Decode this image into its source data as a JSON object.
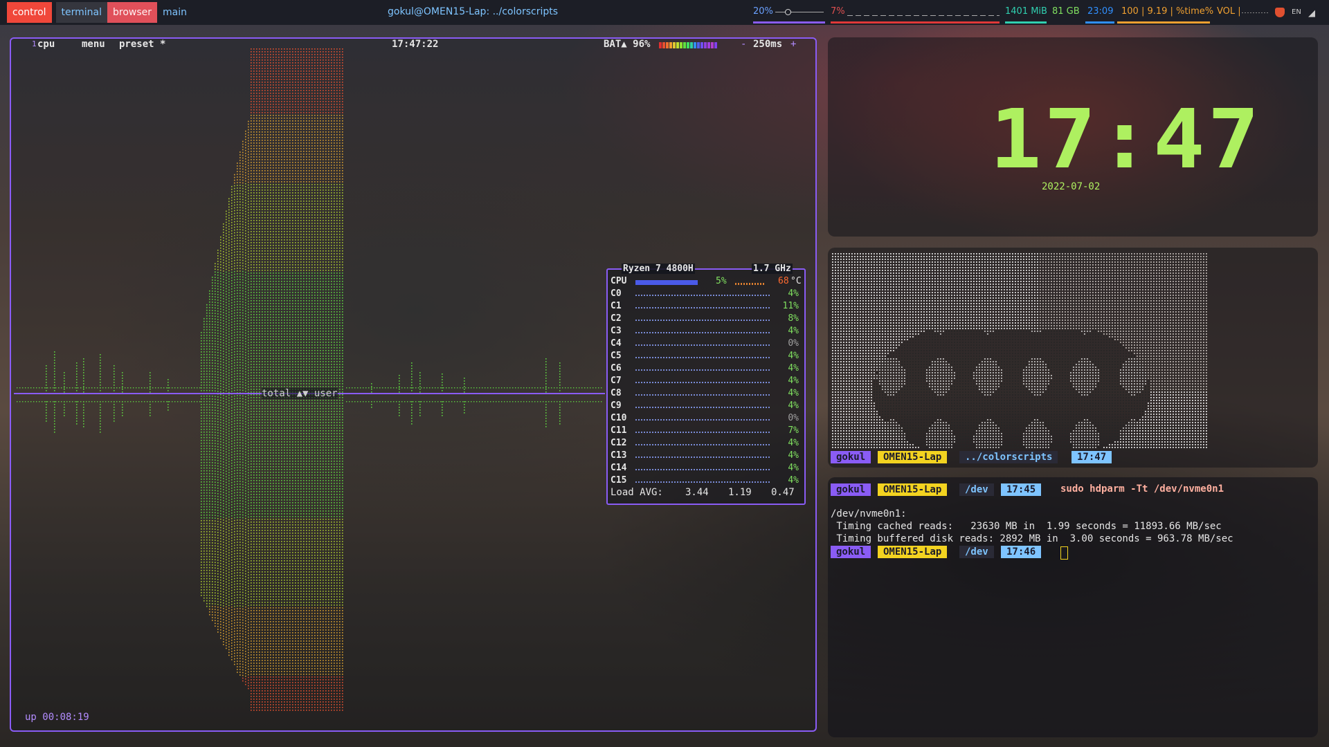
{
  "topbar": {
    "tags": [
      "control",
      "terminal",
      "browser",
      "main"
    ],
    "title": "gokul@OMEN15-Lap: ../colorscripts",
    "brightness": "20%",
    "cpu_usage": "7%",
    "mem": "1401 MiB",
    "disk": "81 GB",
    "time": "23:09",
    "stats": "100 | 9.19 | %time%",
    "vol": "VOL |",
    "lang": "EN",
    "colors": {
      "purple": "#8a5cf5",
      "red": "#e04040",
      "teal": "#30d0b0",
      "blue": "#3090ff",
      "orange": "#f0a030"
    }
  },
  "btop": {
    "tab_cpu": "cpu",
    "tab_cpu_num": "1",
    "tab_menu": "menu",
    "tab_preset": "preset *",
    "clock": "17:47:22",
    "battery": "BAT▲ 96%",
    "interval": "250ms",
    "minus": "-",
    "plus": "+",
    "graph_label": "total ▲▼ user",
    "uptime": "up 00:08:19",
    "cpu_panel": {
      "model": "Ryzen 7 4800H",
      "freq": "1.7 GHz",
      "cpu_label": "CPU",
      "cpu_pct": "5%",
      "temp": "68",
      "temp_unit": "°C",
      "cores": [
        {
          "name": "C0",
          "pct": "4%"
        },
        {
          "name": "C1",
          "pct": "11%"
        },
        {
          "name": "C2",
          "pct": "8%"
        },
        {
          "name": "C3",
          "pct": "4%"
        },
        {
          "name": "C4",
          "pct": "0%"
        },
        {
          "name": "C5",
          "pct": "4%"
        },
        {
          "name": "C6",
          "pct": "4%"
        },
        {
          "name": "C7",
          "pct": "4%"
        },
        {
          "name": "C8",
          "pct": "4%"
        },
        {
          "name": "C9",
          "pct": "4%"
        },
        {
          "name": "C10",
          "pct": "0%"
        },
        {
          "name": "C11",
          "pct": "7%"
        },
        {
          "name": "C12",
          "pct": "4%"
        },
        {
          "name": "C13",
          "pct": "4%"
        },
        {
          "name": "C14",
          "pct": "4%"
        },
        {
          "name": "C15",
          "pct": "4%"
        }
      ],
      "load_label": "Load AVG:",
      "load1": "3.44",
      "load5": "1.19",
      "load15": "0.47"
    }
  },
  "clock_widget": {
    "time": "17:47",
    "date": "2022-07-02"
  },
  "art_prompt": {
    "user": "gokul",
    "host": "OMEN15-Lap",
    "dir": "../colorscripts",
    "time": "17:47"
  },
  "terminal": {
    "prompt1": {
      "user": "gokul",
      "host": "OMEN15-Lap",
      "dir": "/dev",
      "time": "17:45"
    },
    "command": "sudo hdparm -Tt /dev/nvme0n1",
    "out1": "/dev/nvme0n1:",
    "out2": " Timing cached reads:   23630 MB in  1.99 seconds = 11893.66 MB/sec",
    "out3": " Timing buffered disk reads: 2892 MB in  3.00 seconds = 963.78 MB/sec",
    "prompt2": {
      "user": "gokul",
      "host": "OMEN15-Lap",
      "dir": "/dev",
      "time": "17:46"
    }
  }
}
